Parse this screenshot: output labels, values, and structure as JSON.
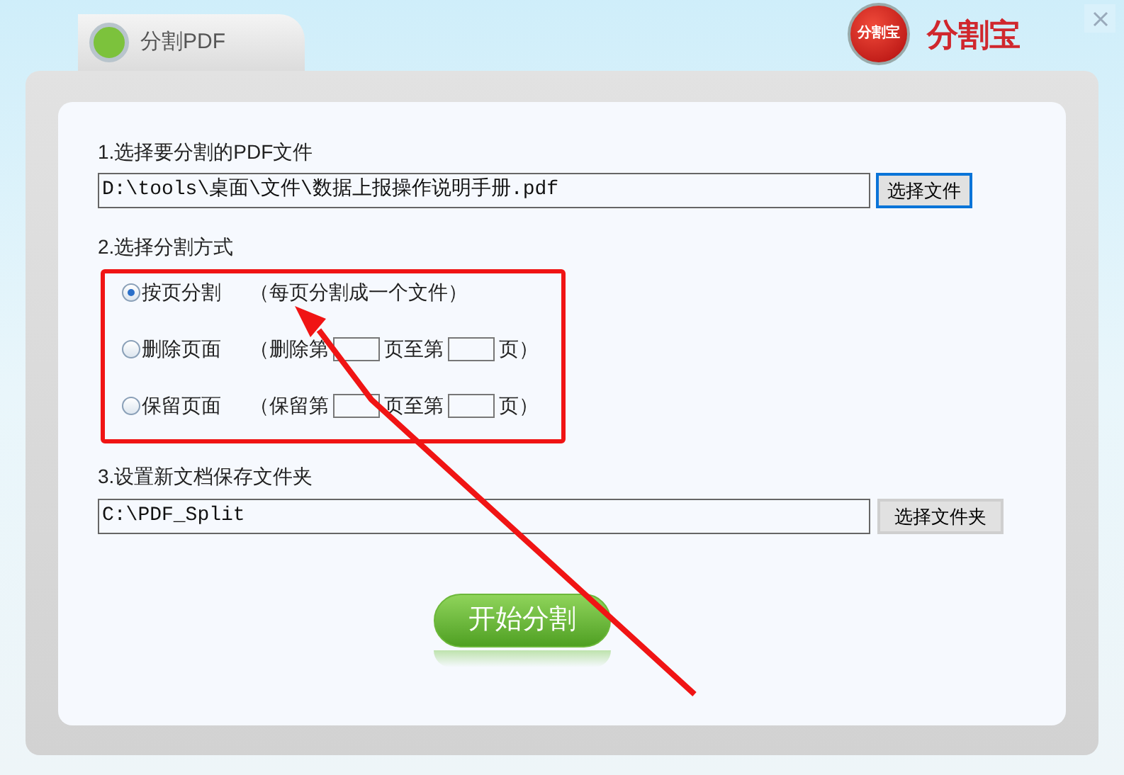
{
  "window": {
    "tab_title": "分割PDF",
    "logo_text": "分割宝",
    "brand": "分割宝"
  },
  "source": {
    "label": "1.选择要分割的PDF文件",
    "value": "D:\\tools\\桌面\\文件\\数据上报操作说明手册.pdf",
    "button": "选择文件",
    "button_focused": true
  },
  "mode": {
    "label": "2.选择分割方式",
    "options": [
      {
        "kind": "note",
        "label": "按页分割",
        "selected": true,
        "note": "（每页分割成一个文件）"
      },
      {
        "kind": "range",
        "label": "删除页面",
        "selected": false,
        "prefix": "（删除第",
        "middle": "页至第",
        "suffix": "页）"
      },
      {
        "kind": "range",
        "label": "保留页面",
        "selected": false,
        "prefix": "（保留第",
        "middle": "页至第",
        "suffix": "页）"
      }
    ]
  },
  "output": {
    "label": "3.设置新文档保存文件夹",
    "value": "C:\\PDF_Split",
    "button": "选择文件夹",
    "button_focused": false
  },
  "start_button": "开始分割"
}
